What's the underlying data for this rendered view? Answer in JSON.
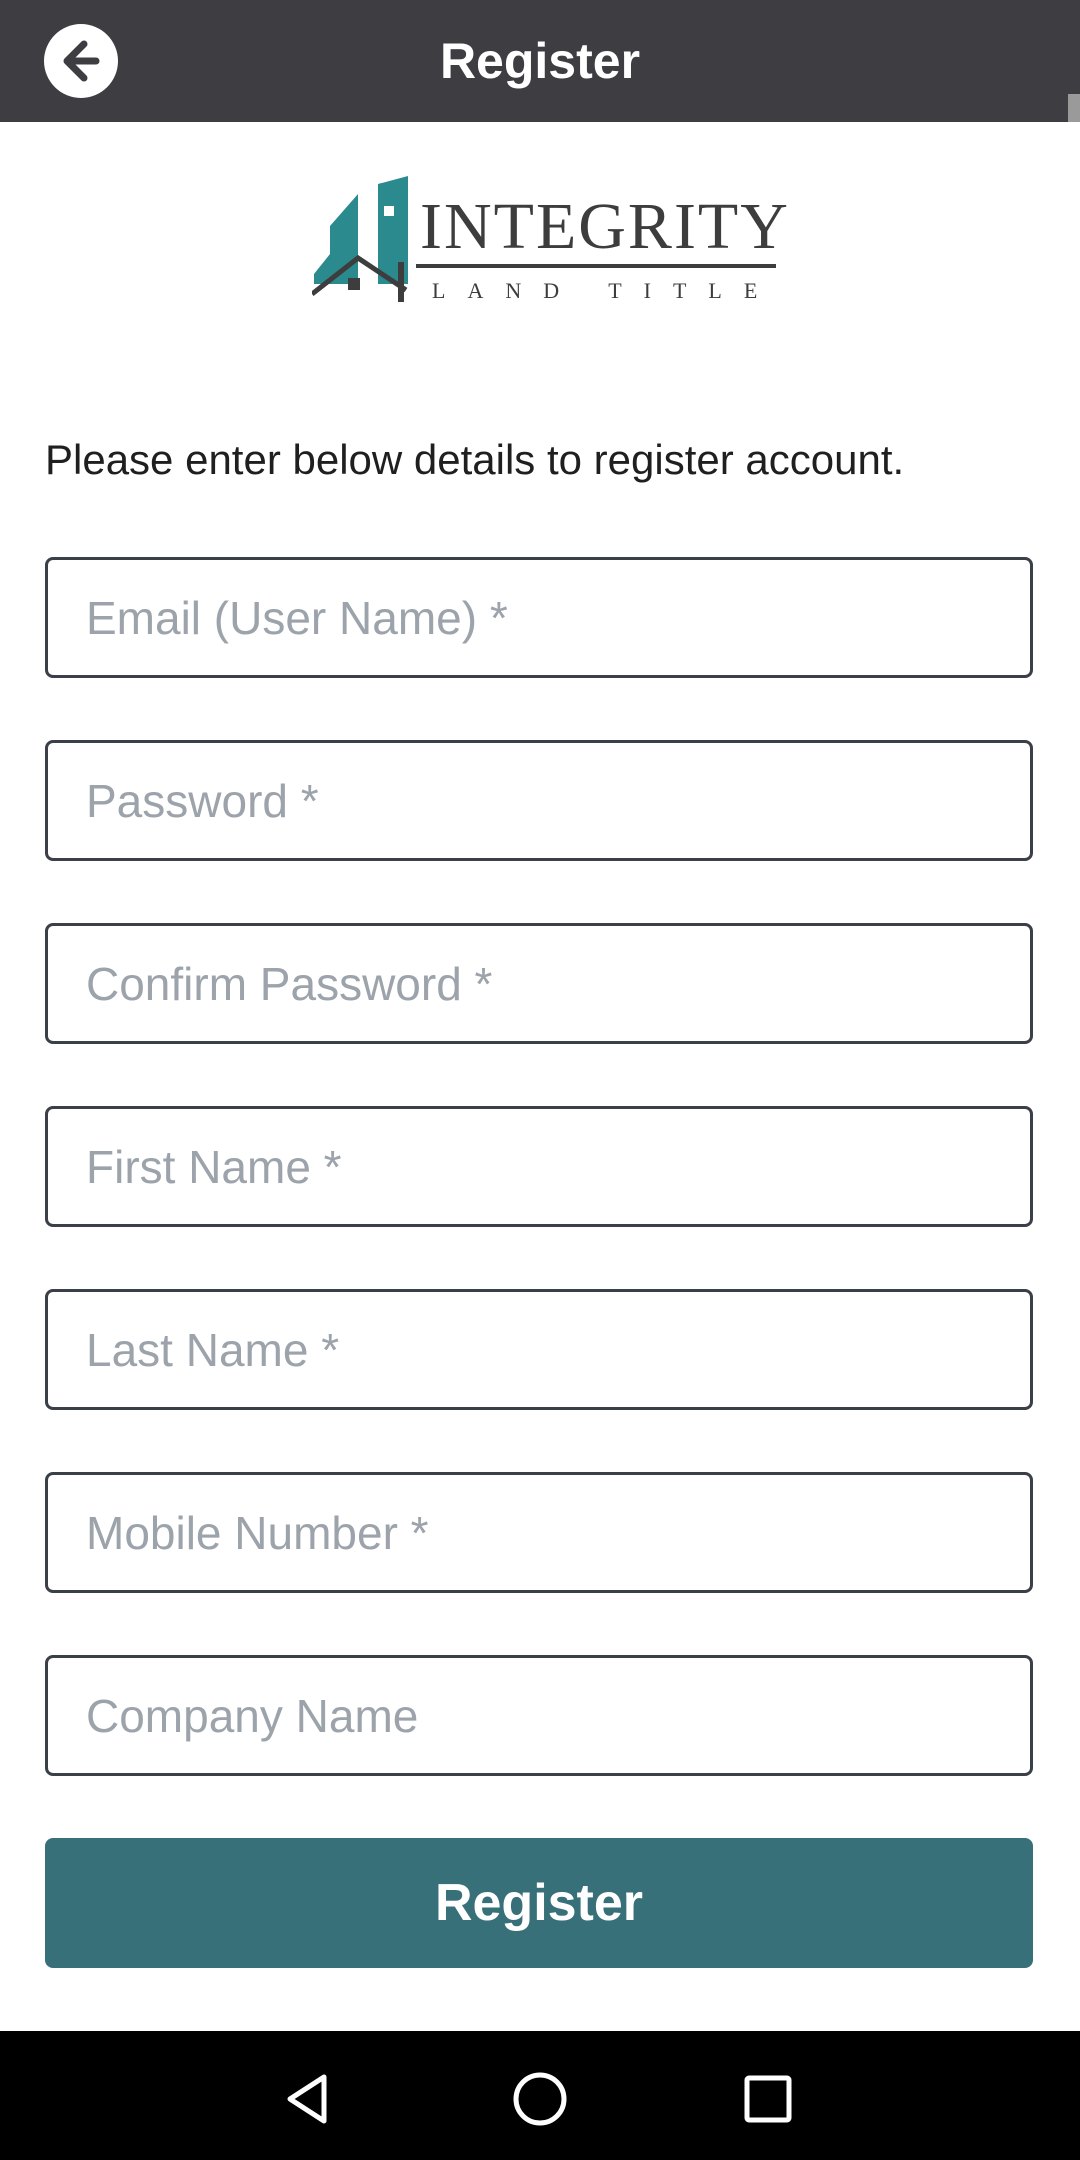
{
  "header": {
    "title": "Register",
    "back_icon": "arrow-left-circle-icon"
  },
  "logo": {
    "wordmark": "INTEGRITY",
    "subtitle": "LAND TITLE",
    "brand_color": "#2a8a8e"
  },
  "instructions": "Please enter below details to register account.",
  "form": {
    "fields": [
      {
        "placeholder": "Email (User Name) *",
        "value": ""
      },
      {
        "placeholder": "Password *",
        "value": ""
      },
      {
        "placeholder": "Confirm Password *",
        "value": ""
      },
      {
        "placeholder": "First Name *",
        "value": ""
      },
      {
        "placeholder": "Last Name *",
        "value": ""
      },
      {
        "placeholder": "Mobile Number *",
        "value": ""
      },
      {
        "placeholder": "Company Name",
        "value": ""
      }
    ],
    "submit_label": "Register",
    "submit_color": "#387079"
  },
  "navbar": {
    "icons": [
      "back-triangle-icon",
      "home-circle-icon",
      "recents-square-icon"
    ]
  }
}
